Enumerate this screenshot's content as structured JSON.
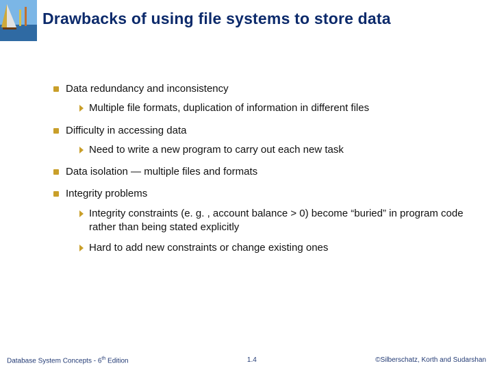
{
  "title": "Drawbacks of using file systems to store data",
  "bullets": [
    {
      "text": "Data redundancy and inconsistency",
      "subs": [
        "Multiple file formats, duplication of information in different files"
      ]
    },
    {
      "text": "Difficulty in accessing data",
      "subs": [
        "Need to write a new program to carry out each new task"
      ]
    },
    {
      "text": "Data isolation — multiple files and formats",
      "subs": []
    },
    {
      "text": "Integrity problems",
      "subs": [
        "Integrity constraints  (e. g. , account balance > 0) become “buried” in program code rather than being stated explicitly",
        "Hard to add new constraints or change existing ones"
      ]
    }
  ],
  "footer": {
    "left_a": "Database System Concepts - 6",
    "left_sup": "th",
    "left_b": " Edition",
    "center": "1.4",
    "right": "©Silberschatz, Korth and Sudarshan"
  }
}
